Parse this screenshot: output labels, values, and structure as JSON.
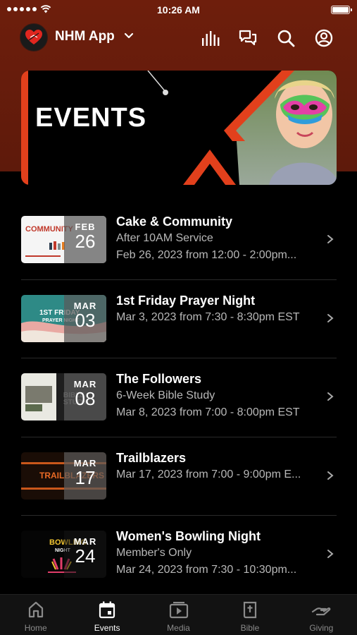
{
  "status_bar": {
    "time": "10:26 AM"
  },
  "header": {
    "app_name": "NHM App"
  },
  "banner": {
    "title": "EVENTS"
  },
  "events": [
    {
      "title": "Cake & Community",
      "line1": "After 10AM Service",
      "line2": "Feb 26, 2023 from 12:00 - 2:00pm...",
      "month": "FEB",
      "day": "26"
    },
    {
      "title": "1st Friday Prayer Night",
      "line1": "Mar 3, 2023 from 7:30 - 8:30pm EST",
      "line2": "",
      "month": "MAR",
      "day": "03"
    },
    {
      "title": "The Followers",
      "line1": "6-Week Bible Study",
      "line2": "Mar 8, 2023 from 7:00 - 8:00pm EST",
      "month": "MAR",
      "day": "08"
    },
    {
      "title": "Trailblazers",
      "line1": "Mar 17, 2023 from 7:00 - 9:00pm E...",
      "line2": "",
      "month": "MAR",
      "day": "17"
    },
    {
      "title": "Women's Bowling Night",
      "line1": "Member's Only",
      "line2": "Mar 24, 2023 from 7:30 - 10:30pm...",
      "month": "MAR",
      "day": "24"
    }
  ],
  "tabs": [
    {
      "label": "Home",
      "icon": "home-icon"
    },
    {
      "label": "Events",
      "icon": "calendar-icon"
    },
    {
      "label": "Media",
      "icon": "media-icon"
    },
    {
      "label": "Bible",
      "icon": "bible-icon"
    },
    {
      "label": "Giving",
      "icon": "giving-icon"
    }
  ],
  "colors": {
    "header_bg": "#6e1e0c",
    "accent": "#e2401c",
    "background": "#000000"
  }
}
